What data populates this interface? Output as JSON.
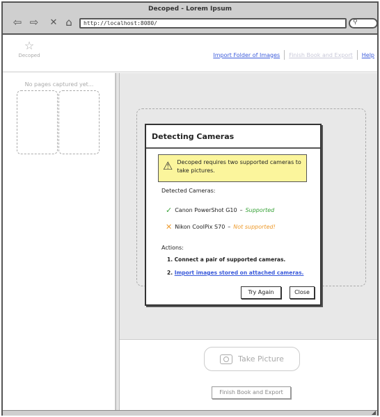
{
  "window": {
    "title": "Decoped - Lorem Ipsum"
  },
  "browser": {
    "url": "http://localhost:8080/"
  },
  "app": {
    "name": "Decoped"
  },
  "toolbar": {
    "import_label": "Import Folder of Images",
    "finish_label": "Finish Book and Export",
    "help_label": "Help"
  },
  "sidebar": {
    "empty_text": "No pages captured yet..."
  },
  "main": {
    "take_picture_label": "Take Picture",
    "finish_button_label": "Finish Book and Export"
  },
  "dialog": {
    "title": "Detecting Cameras",
    "warning": "Decoped requires two supported cameras to take pictures.",
    "detected_label": "Detected Cameras:",
    "cameras": [
      {
        "name": "Canon PowerShot G10",
        "status": "Supported",
        "supported": true
      },
      {
        "name": "Nikon CoolPix S70",
        "status": "Not supported!",
        "supported": false
      }
    ],
    "actions_label": "Actions:",
    "action_1": "1. Connect a pair of supported cameras.",
    "action_2_prefix": "2.",
    "action_2_link": "Import images stored on attached cameras.",
    "try_again_label": "Try Again",
    "close_label": "Close"
  },
  "colors": {
    "link": "#3b5bdb",
    "supported": "#3aa33a",
    "not_supported": "#ee9a2b",
    "warning_bg": "#fbf59c"
  }
}
